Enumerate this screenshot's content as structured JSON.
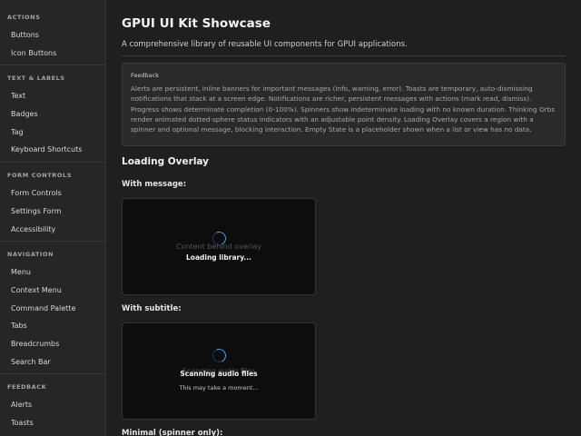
{
  "sidebar": {
    "sections": [
      {
        "heading": "ACTIONS",
        "items": [
          "Buttons",
          "Icon Buttons"
        ]
      },
      {
        "heading": "TEXT & LABELS",
        "items": [
          "Text",
          "Badges",
          "Tag",
          "Keyboard Shortcuts"
        ]
      },
      {
        "heading": "FORM CONTROLS",
        "items": [
          "Form Controls",
          "Settings Form",
          "Accessibility"
        ]
      },
      {
        "heading": "NAVIGATION",
        "items": [
          "Menu",
          "Context Menu",
          "Command Palette",
          "Tabs",
          "Breadcrumbs",
          "Search Bar"
        ]
      },
      {
        "heading": "FEEDBACK",
        "items": [
          "Alerts",
          "Toasts"
        ]
      }
    ]
  },
  "main": {
    "title": "GPUI UI Kit Showcase",
    "subtitle": "A comprehensive library of reusable UI components for GPUI applications.",
    "card": {
      "heading": "Feedback",
      "text": "Alerts are persistent, inline banners for important messages (info, warning, error). Toasts are temporary, auto-dismissing notifications that stack at a screen edge. Notifications are richer, persistent messages with actions (mark read, dismiss). Progress shows determinate completion (0-100%). Spinners show indeterminate loading with no known duration. Thinking Orbs render animated dotted-sphere status indicators with an adjustable point density. Loading Overlay covers a region with a spinner and optional message, blocking interaction. Empty State is a placeholder shown when a list or view has no data."
    },
    "section_title": "Loading Overlay",
    "demos": [
      {
        "label": "With message:",
        "behind": "Content behind overlay",
        "message": "Loading library...",
        "sub": ""
      },
      {
        "label": "With subtitle:",
        "behind": "Scanning audio files",
        "message": "Scanning audio files",
        "sub": "This may take a moment..."
      },
      {
        "label": "Minimal (spinner only):"
      }
    ]
  }
}
